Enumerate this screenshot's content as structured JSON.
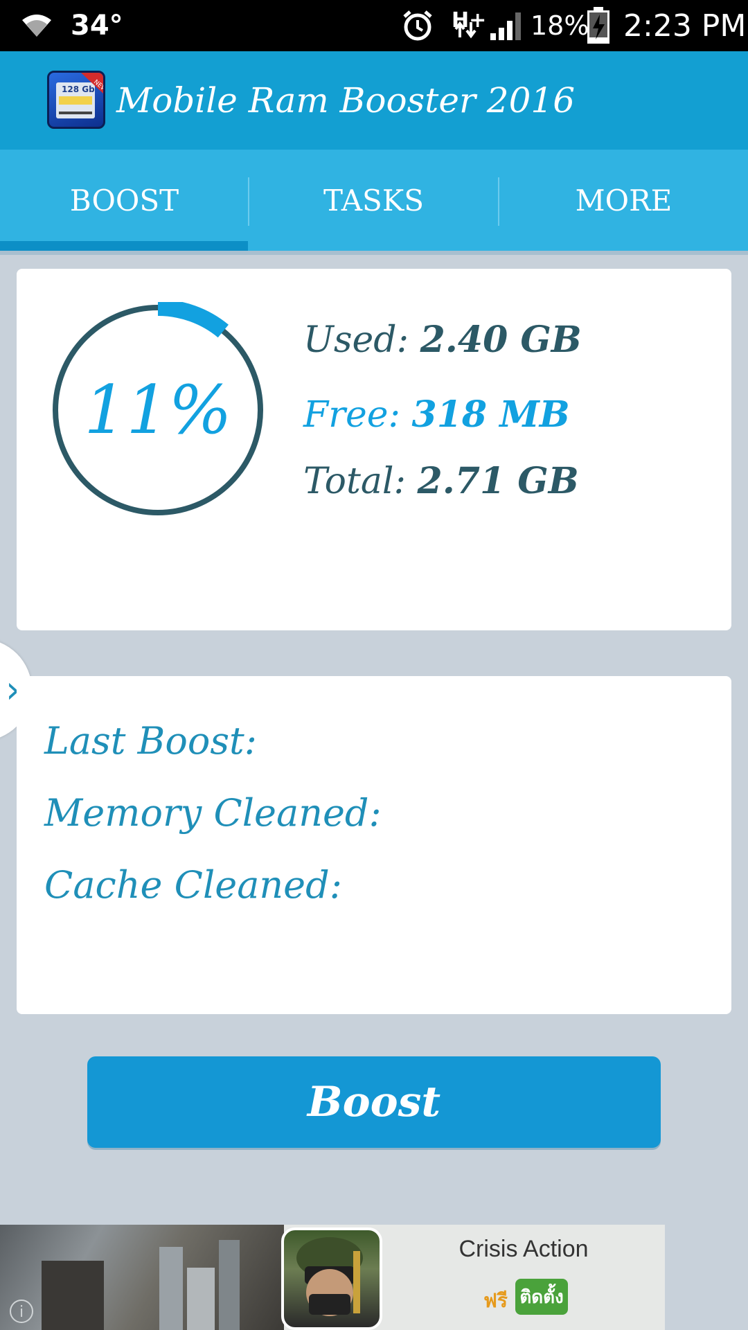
{
  "status_bar": {
    "temperature": "34°",
    "network_type": "H+",
    "battery": "18%",
    "time": "2:23 PM",
    "icons": [
      "wifi-icon",
      "alarm-icon",
      "signal-icon",
      "battery-charging-icon"
    ]
  },
  "app_bar": {
    "title": "Mobile Ram Booster 2016",
    "icon_text": "128 Gb",
    "icon_badge": "NEW"
  },
  "tabs": [
    {
      "label": "BOOST",
      "selected": true
    },
    {
      "label": "TASKS",
      "selected": false
    },
    {
      "label": "MORE",
      "selected": false
    }
  ],
  "memory": {
    "percent_label": "11%",
    "percent_value": 11,
    "used_label": "Used:",
    "used_value": "2.40 GB",
    "free_label": "Free:",
    "free_value": "318 MB",
    "total_label": "Total:",
    "total_value": "2.71 GB"
  },
  "boost_info": {
    "last_boost_label": "Last Boost:",
    "memory_cleaned_label": "Memory Cleaned:",
    "cache_cleaned_label": "Cache Cleaned:"
  },
  "boost_button": {
    "label": "Boost"
  },
  "ad": {
    "title": "Crisis Action",
    "free_label": "ฟรี",
    "install_label": "ติดตั้ง",
    "info_symbol": "i"
  },
  "colors": {
    "status_bar": "#000000",
    "app_bar": "#139fd2",
    "tab_bar": "#30b3e2",
    "tab_indicator": "#0c8fc6",
    "background": "#c8d1da",
    "ring_track": "#2c5966",
    "ring_progress": "#12a1e0",
    "boost_button": "#1497d4"
  }
}
